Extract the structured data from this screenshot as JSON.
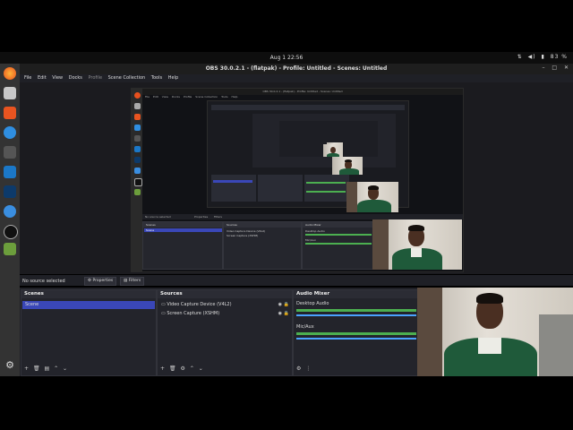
{
  "system": {
    "clock": "Aug 1  22:56",
    "battery": "83 %"
  },
  "window": {
    "title": "OBS 30.0.2.1 - (flatpak) - Profile: Untitled - Scenes: Untitled"
  },
  "menu": [
    "File",
    "Edit",
    "View",
    "Docks",
    "Profile",
    "Scene Collection",
    "Tools",
    "Help"
  ],
  "preview": {
    "nested_title": "OBS 30.0.2.1 - (flatpak) - Profile: Untitled - Scenes: Untitled",
    "nested_menu": [
      "File",
      "Edit",
      "View",
      "Docks",
      "Profile",
      "Scene Collection",
      "Tools",
      "Help"
    ],
    "nested_no_source": "No source selected",
    "nested_tabs": [
      "Properties",
      "Filters"
    ],
    "nested_scenes_title": "Scenes",
    "nested_scene_item": "Scene",
    "nested_sources_title": "Sources",
    "nested_sources": [
      "Video Capture Device (V4L2)",
      "Screen Capture (XSHM)"
    ],
    "nested_audio_title": "Audio Mixer",
    "nested_audio": [
      "Desktop Audio",
      "Mic/Aux"
    ]
  },
  "properties_bar": {
    "no_source": "No source selected",
    "properties_label": "Properties",
    "filters_label": "Filters"
  },
  "scenes": {
    "title": "Scenes",
    "items": [
      "Scene"
    ]
  },
  "sources": {
    "title": "Sources",
    "items": [
      "Video Capture Device (V4L2)",
      "Screen Capture (XSHM)"
    ]
  },
  "audio_mixer": {
    "title": "Audio Mixer",
    "channels": [
      "Desktop Audio",
      "Mic/Aux"
    ]
  },
  "colors": {
    "accent": "#3a47b8",
    "meter_green": "#4caf50",
    "meter_blue": "#4aa3ff"
  }
}
